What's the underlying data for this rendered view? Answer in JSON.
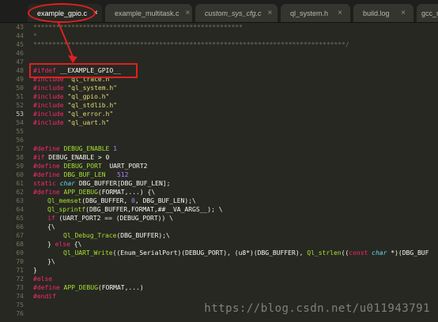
{
  "tabs": [
    {
      "label": "example_gpio.c",
      "close": "×",
      "active": true,
      "italic": false
    },
    {
      "label": "example_multitask.c",
      "close": "×",
      "active": false,
      "italic": false
    },
    {
      "label": "custom_sys_cfg.c",
      "close": "×",
      "active": false,
      "italic": true
    },
    {
      "label": "ql_system.h",
      "close": "×",
      "active": false,
      "italic": false
    },
    {
      "label": "build.log",
      "close": "×",
      "active": false,
      "italic": false
    },
    {
      "label": "gcc_ma",
      "close": "",
      "active": false,
      "italic": false
    }
  ],
  "line_numbers": [
    "43",
    "44",
    "45",
    "46",
    "47",
    "48",
    "49",
    "50",
    "51",
    "52",
    "53",
    "54",
    "55",
    "56",
    "57",
    "58",
    "59",
    "60",
    "61",
    "62",
    "63",
    "64",
    "65",
    "66",
    "67",
    "68",
    "69",
    "70",
    "71",
    "72",
    "73",
    "74",
    "75",
    "76"
  ],
  "current_line": "53",
  "code": {
    "l43": "*******************************************************",
    "l44": "*",
    "l45": "**********************************************************************************/",
    "l48_kw": "#ifdef",
    "l48_rest": " __EXAMPLE_GPIO__",
    "l49_kw": "#include",
    "l49_str": " \"ql_trace.h\"",
    "l50_kw": "#include",
    "l50_str": " \"ql_system.h\"",
    "l51_kw": "#include",
    "l51_str": " \"ql_gpio.h\"",
    "l52_kw": "#include",
    "l52_str": " \"ql_stdlib.h\"",
    "l53_kw": "#include",
    "l53_str": " \"ql_error.h\"",
    "l54_kw": "#include",
    "l54_str": " \"ql_uart.h\"",
    "l57_kw": "#define",
    "l57_name": " DEBUG_ENABLE",
    "l57_num": " 1",
    "l58_kw": "#if",
    "l58_rest": " DEBUG_ENABLE > 0",
    "l59_kw": "#define",
    "l59_name": " DEBUG_PORT",
    "l59_rest": "  UART_PORT2",
    "l60_kw": "#define",
    "l60_name": " DBG_BUF_LEN",
    "l60_num": "   512",
    "l61_kw": "static",
    "l61_ty": " char",
    "l61_rest": " DBG_BUFFER[DBG_BUF_LEN];",
    "l62_kw": "#define",
    "l62_name": " APP_DEBUG",
    "l62_rest": "(FORMAT,...) {\\",
    "l63_fn": "Ql_memset",
    "l63_a": "(DBG_BUFFER, ",
    "l63_num": "0",
    "l63_b": ", DBG_BUF_LEN);\\",
    "l64_fn": "Ql_sprintf",
    "l64_rest": "(DBG_BUFFER,FORMAT,##__VA_ARGS__); \\",
    "l65_kw": "if",
    "l65_rest": " (UART_PORT2 == (DEBUG_PORT)) \\",
    "l66": "{\\",
    "l67_fn": "Ql_Debug_Trace",
    "l67_rest": "(DBG_BUFFER);\\",
    "l68_a": "} ",
    "l68_kw": "else",
    "l68_b": " {\\",
    "l69_fn": "Ql_UART_Write",
    "l69_a": "((Enum_SerialPort)(DEBUG_PORT), (u8*)(DBG_BUFFER), ",
    "l69_fn2": "Ql_strlen",
    "l69_b": "((",
    "l69_kw": "const",
    "l69_ty": " char",
    "l69_c": " *)(DBG_BUF",
    "l70": "}\\",
    "l71": "}",
    "l72_kw": "#else",
    "l73_kw": "#define",
    "l73_name": " APP_DEBUG",
    "l73_rest": "(FORMAT,...)",
    "l74_kw": "#endif"
  },
  "watermark": "https://blog.csdn.net/u011943791",
  "colors": {
    "background": "#272822",
    "keyword": "#f92672",
    "string": "#e6db74",
    "number": "#ae81ff",
    "function": "#a6e22e",
    "annotation": "#e02020"
  }
}
